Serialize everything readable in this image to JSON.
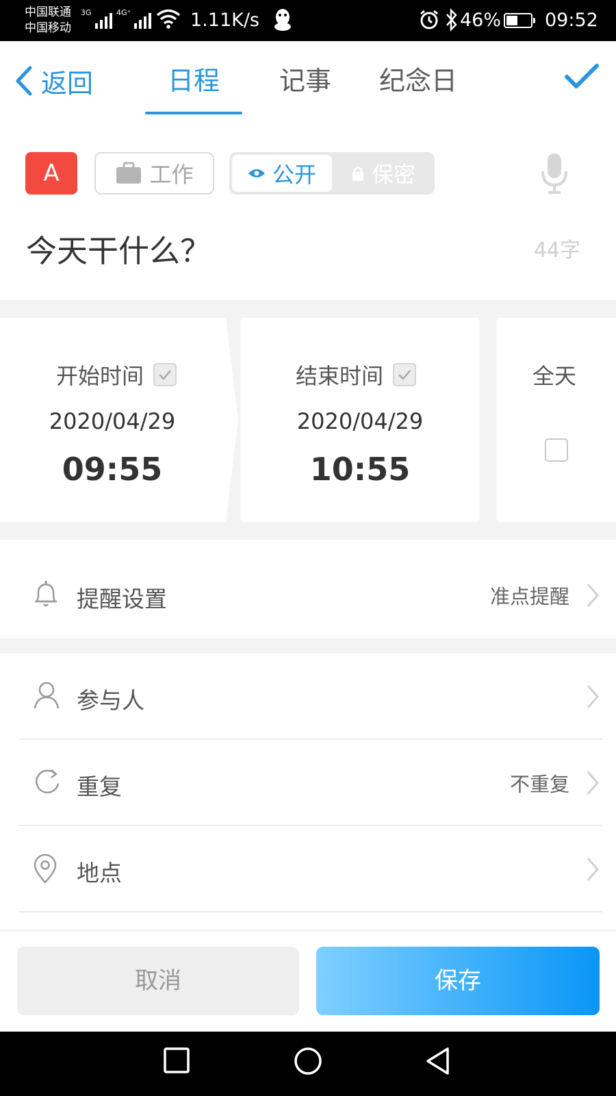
{
  "status_bar": {
    "carrier1": "中国联通",
    "carrier2": "中国移动",
    "net1": "3G",
    "net2": "4G⁺",
    "speed": "1.11K/s",
    "battery": "46%",
    "battery_level": 0.46,
    "time": "09:52"
  },
  "header": {
    "back_label": "返回",
    "tabs": [
      {
        "label": "日程",
        "active": true
      },
      {
        "label": "记事",
        "active": false
      },
      {
        "label": "纪念日",
        "active": false
      }
    ]
  },
  "toolbar": {
    "tag_letter": "A",
    "category": "工作",
    "visibility_public": "公开",
    "visibility_private": "保密"
  },
  "title_input": {
    "value": "今天干什么？",
    "count": "44字"
  },
  "time": {
    "start": {
      "label": "开始时间",
      "date": "2020/04/29",
      "time": "09:55",
      "checked": true
    },
    "end": {
      "label": "结束时间",
      "date": "2020/04/29",
      "time": "10:55",
      "checked": true
    },
    "all_day": {
      "label": "全天",
      "checked": false
    }
  },
  "rows": {
    "reminder": {
      "label": "提醒设置",
      "value": "准点提醒"
    },
    "participants": {
      "label": "参与人",
      "value": ""
    },
    "repeat": {
      "label": "重复",
      "value": "不重复"
    },
    "location": {
      "label": "地点",
      "value": ""
    }
  },
  "buttons": {
    "cancel": "取消",
    "save": "保存"
  },
  "colors": {
    "accent": "#2a95de",
    "tag_red": "#f24a3f",
    "save_gradient_start": "#7fd0ff",
    "save_gradient_end": "#0a96f7"
  }
}
